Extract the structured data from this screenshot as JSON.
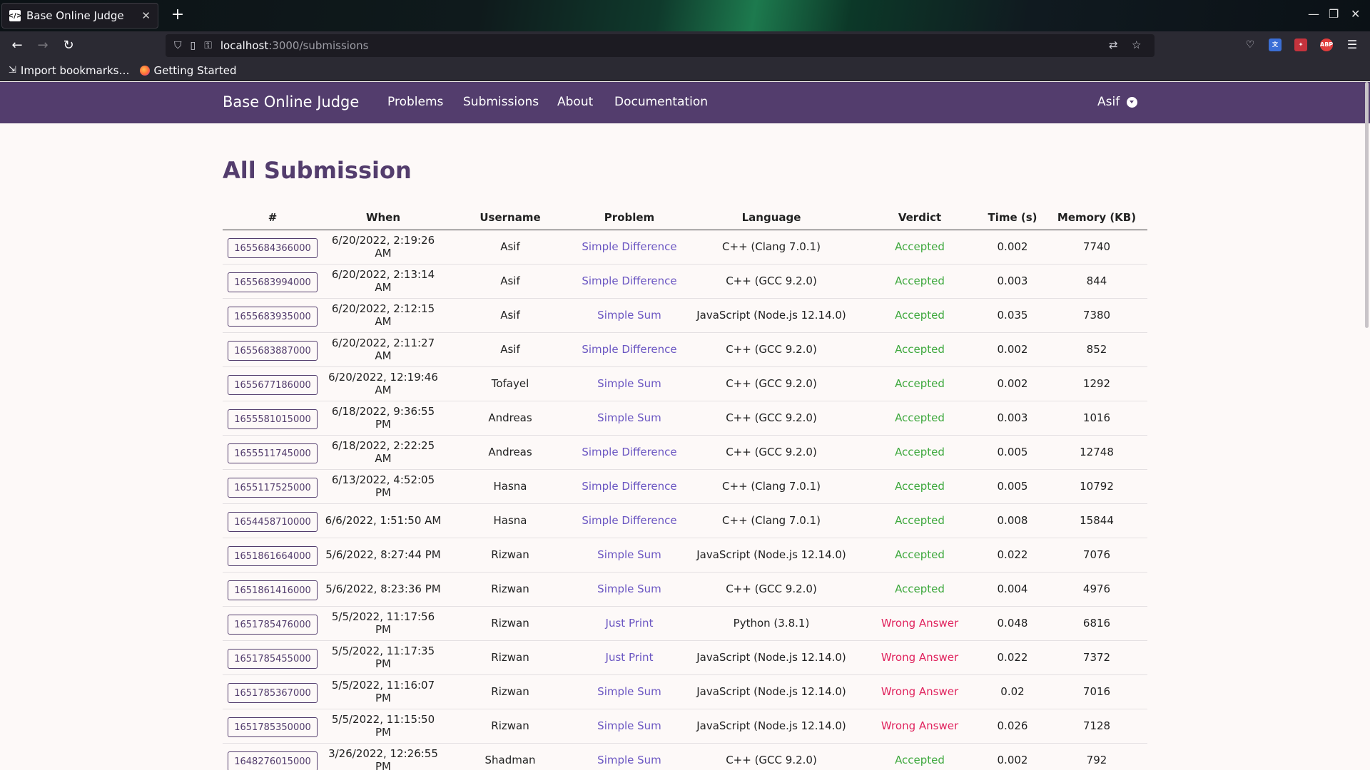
{
  "browser": {
    "tab_title": "Base Online Judge",
    "url_host": "localhost",
    "url_path": ":3000/submissions",
    "bookmarks": [
      "Import bookmarks…",
      "Getting Started"
    ]
  },
  "header": {
    "brand": "Base Online Judge",
    "menu": [
      "Problems",
      "Submissions",
      "About",
      "Documentation"
    ],
    "user": "Asif"
  },
  "page": {
    "title": "All Submission",
    "columns": [
      "#",
      "When",
      "Username",
      "Problem",
      "Language",
      "Verdict",
      "Time (s)",
      "Memory (KB)"
    ],
    "rows": [
      {
        "id": "1655684366000",
        "when": "6/20/2022, 2:19:26 AM",
        "user": "Asif",
        "problem": "Simple Difference",
        "language": "C++ (Clang 7.0.1)",
        "verdict": "Accepted",
        "time": "0.002",
        "memory": "7740"
      },
      {
        "id": "1655683994000",
        "when": "6/20/2022, 2:13:14 AM",
        "user": "Asif",
        "problem": "Simple Difference",
        "language": "C++ (GCC 9.2.0)",
        "verdict": "Accepted",
        "time": "0.003",
        "memory": "844"
      },
      {
        "id": "1655683935000",
        "when": "6/20/2022, 2:12:15 AM",
        "user": "Asif",
        "problem": "Simple Sum",
        "language": "JavaScript (Node.js 12.14.0)",
        "verdict": "Accepted",
        "time": "0.035",
        "memory": "7380"
      },
      {
        "id": "1655683887000",
        "when": "6/20/2022, 2:11:27 AM",
        "user": "Asif",
        "problem": "Simple Difference",
        "language": "C++ (GCC 9.2.0)",
        "verdict": "Accepted",
        "time": "0.002",
        "memory": "852"
      },
      {
        "id": "1655677186000",
        "when": "6/20/2022, 12:19:46 AM",
        "user": "Tofayel",
        "problem": "Simple Sum",
        "language": "C++ (GCC 9.2.0)",
        "verdict": "Accepted",
        "time": "0.002",
        "memory": "1292"
      },
      {
        "id": "1655581015000",
        "when": "6/18/2022, 9:36:55 PM",
        "user": "Andreas",
        "problem": "Simple Sum",
        "language": "C++ (GCC 9.2.0)",
        "verdict": "Accepted",
        "time": "0.003",
        "memory": "1016"
      },
      {
        "id": "1655511745000",
        "when": "6/18/2022, 2:22:25 AM",
        "user": "Andreas",
        "problem": "Simple Difference",
        "language": "C++ (GCC 9.2.0)",
        "verdict": "Accepted",
        "time": "0.005",
        "memory": "12748"
      },
      {
        "id": "1655117525000",
        "when": "6/13/2022, 4:52:05 PM",
        "user": "Hasna",
        "problem": "Simple Difference",
        "language": "C++ (Clang 7.0.1)",
        "verdict": "Accepted",
        "time": "0.005",
        "memory": "10792"
      },
      {
        "id": "1654458710000",
        "when": "6/6/2022, 1:51:50 AM",
        "user": "Hasna",
        "problem": "Simple Difference",
        "language": "C++ (Clang 7.0.1)",
        "verdict": "Accepted",
        "time": "0.008",
        "memory": "15844"
      },
      {
        "id": "1651861664000",
        "when": "5/6/2022, 8:27:44 PM",
        "user": "Rizwan",
        "problem": "Simple Sum",
        "language": "JavaScript (Node.js 12.14.0)",
        "verdict": "Accepted",
        "time": "0.022",
        "memory": "7076"
      },
      {
        "id": "1651861416000",
        "when": "5/6/2022, 8:23:36 PM",
        "user": "Rizwan",
        "problem": "Simple Sum",
        "language": "C++ (GCC 9.2.0)",
        "verdict": "Accepted",
        "time": "0.004",
        "memory": "4976"
      },
      {
        "id": "1651785476000",
        "when": "5/5/2022, 11:17:56 PM",
        "user": "Rizwan",
        "problem": "Just Print",
        "language": "Python (3.8.1)",
        "verdict": "Wrong Answer",
        "time": "0.048",
        "memory": "6816"
      },
      {
        "id": "1651785455000",
        "when": "5/5/2022, 11:17:35 PM",
        "user": "Rizwan",
        "problem": "Just Print",
        "language": "JavaScript (Node.js 12.14.0)",
        "verdict": "Wrong Answer",
        "time": "0.022",
        "memory": "7372"
      },
      {
        "id": "1651785367000",
        "when": "5/5/2022, 11:16:07 PM",
        "user": "Rizwan",
        "problem": "Simple Sum",
        "language": "JavaScript (Node.js 12.14.0)",
        "verdict": "Wrong Answer",
        "time": "0.02",
        "memory": "7016"
      },
      {
        "id": "1651785350000",
        "when": "5/5/2022, 11:15:50 PM",
        "user": "Rizwan",
        "problem": "Simple Sum",
        "language": "JavaScript (Node.js 12.14.0)",
        "verdict": "Wrong Answer",
        "time": "0.026",
        "memory": "7128"
      },
      {
        "id": "1648276015000",
        "when": "3/26/2022, 12:26:55 PM",
        "user": "Shadman",
        "problem": "Simple Sum",
        "language": "C++ (GCC 9.2.0)",
        "verdict": "Accepted",
        "time": "0.002",
        "memory": "792"
      }
    ]
  },
  "colors": {
    "brand_purple": "#533d6d",
    "link": "#6b56c2",
    "accepted": "#3ea83d",
    "wrong_answer": "#e0245e"
  }
}
